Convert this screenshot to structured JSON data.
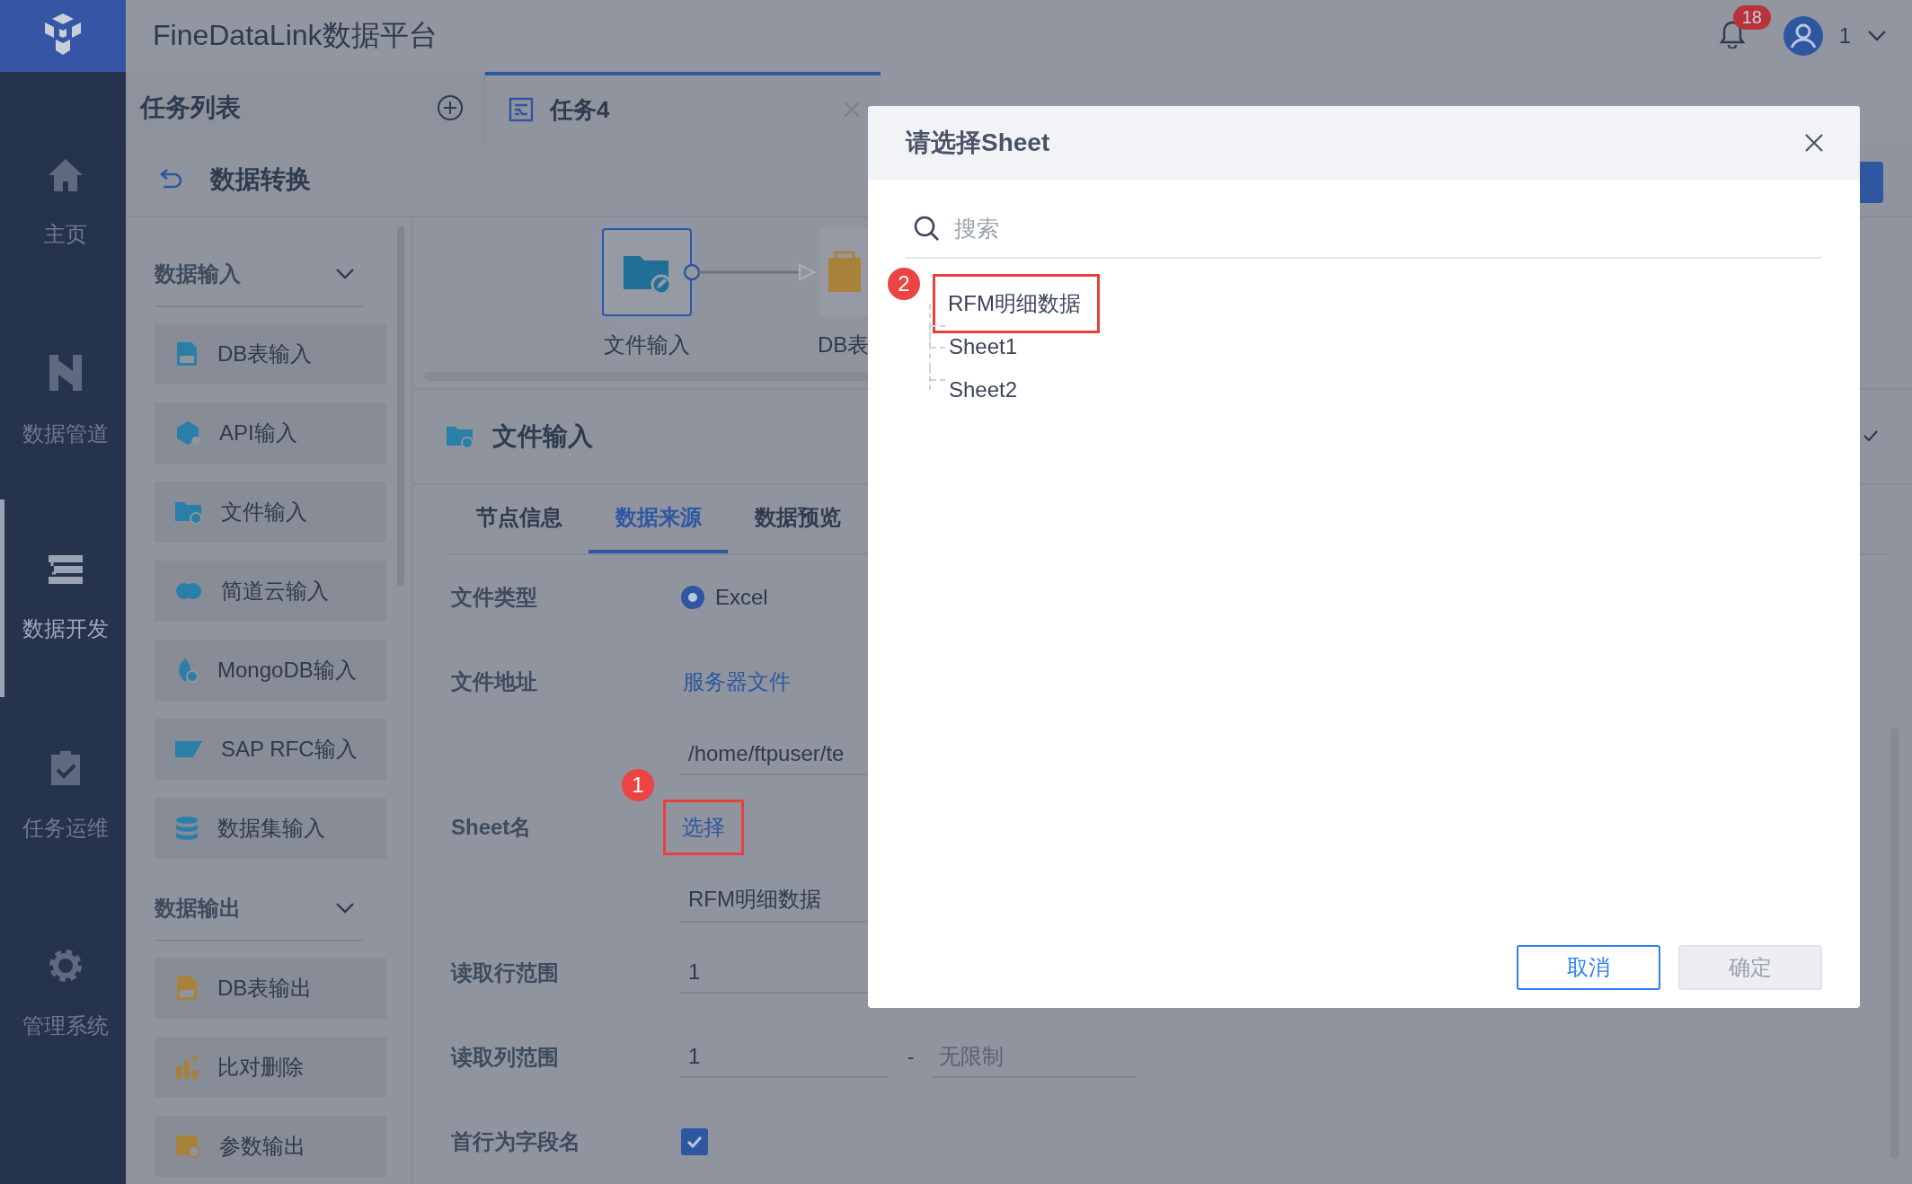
{
  "app": {
    "title": "FineDataLink数据平台"
  },
  "header": {
    "notifications": "18",
    "user": "1"
  },
  "nav": [
    {
      "label": "主页",
      "kind": "home",
      "selected": false
    },
    {
      "label": "数据管道",
      "kind": "pipe",
      "selected": false
    },
    {
      "label": "数据开发",
      "kind": "dev",
      "selected": true
    },
    {
      "label": "任务运维",
      "kind": "ops",
      "selected": false
    },
    {
      "label": "管理系统",
      "kind": "gear",
      "selected": false
    }
  ],
  "task_list": {
    "title": "任务列表"
  },
  "tabs": [
    {
      "label": "任务4",
      "selected": true
    }
  ],
  "breadcrumb": {
    "title": "数据转换"
  },
  "palette": [
    {
      "title": "数据输入",
      "expanded": true,
      "items": [
        {
          "label": "DB表输入",
          "kind": "db"
        },
        {
          "label": "API输入",
          "kind": "api"
        },
        {
          "label": "文件输入",
          "kind": "file"
        },
        {
          "label": "简道云输入",
          "kind": "cloud"
        },
        {
          "label": "MongoDB输入",
          "kind": "leaf"
        },
        {
          "label": "SAP RFC输入",
          "kind": "sap"
        },
        {
          "label": "数据集输入",
          "kind": "dataset"
        }
      ]
    },
    {
      "title": "数据输出",
      "expanded": true,
      "items": [
        {
          "label": "DB表输出",
          "kind": "dbout"
        },
        {
          "label": "比对删除",
          "kind": "compare"
        },
        {
          "label": "参数输出",
          "kind": "param"
        }
      ]
    }
  ],
  "canvas": {
    "nodes": [
      {
        "label": "文件输入",
        "kind": "file",
        "selected": true
      },
      {
        "label": "DB表",
        "kind": "dbout",
        "selected": false
      }
    ]
  },
  "node_panel": {
    "title": "文件输入",
    "tabs": [
      {
        "label": "节点信息",
        "selected": false
      },
      {
        "label": "数据来源",
        "selected": true
      },
      {
        "label": "数据预览",
        "selected": false
      }
    ],
    "fields": [
      {
        "kind": "radio",
        "label": "文件类型",
        "options": [
          {
            "label": "Excel",
            "selected": true
          }
        ]
      },
      {
        "kind": "link",
        "label": "文件地址",
        "value": "服务器文件",
        "highlighted": false
      },
      {
        "kind": "input",
        "value": "/home/ftpuser/te"
      },
      {
        "kind": "link",
        "label": "Sheet名",
        "value": "选择",
        "highlighted": true,
        "callout": "1"
      },
      {
        "kind": "input",
        "value": "RFM明细数据"
      },
      {
        "kind": "input",
        "label": "读取行范围",
        "value": "1"
      },
      {
        "kind": "range",
        "label": "读取列范围",
        "value": "1",
        "separator": "-",
        "placeholder": "无限制"
      },
      {
        "kind": "checkbox",
        "label": "首行为字段名",
        "checked": true
      }
    ]
  },
  "dialog": {
    "title": "请选择Sheet",
    "search": {
      "placeholder": "搜索"
    },
    "callout": "2",
    "sheets": [
      {
        "label": "RFM明细数据",
        "highlighted": true
      },
      {
        "label": "Sheet1",
        "highlighted": false
      },
      {
        "label": "Sheet2",
        "highlighted": false
      }
    ],
    "buttons": [
      {
        "label": "取消",
        "kind": "secondary",
        "disabled": false
      },
      {
        "label": "确定",
        "kind": "primary",
        "disabled": true
      }
    ]
  }
}
